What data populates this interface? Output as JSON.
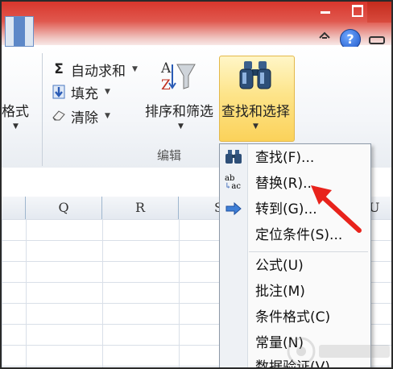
{
  "ribbon": {
    "format_label": "格式",
    "autosum_label": "自动求和",
    "fill_label": "填充",
    "clear_label": "清除",
    "sort_filter_label": "排序和筛选",
    "find_select_label": "查找和选择",
    "group_label": "编辑",
    "sigma_glyph": "Σ",
    "sort_glyph_a": "A",
    "sort_glyph_z": "Z"
  },
  "columns": [
    {
      "label": ""
    },
    {
      "label": "Q"
    },
    {
      "label": "R"
    },
    {
      "label": "S"
    },
    {
      "label": "U"
    }
  ],
  "menu": {
    "items": [
      {
        "label": "查找(F)...",
        "icon": "binoculars-icon"
      },
      {
        "label": "替换(R)...",
        "icon": "replace-ab-ac-icon"
      },
      {
        "label": "转到(G)...",
        "icon": "arrow-right-icon"
      },
      {
        "label": "定位条件(S)...",
        "icon": ""
      },
      {
        "label": "公式(U)",
        "icon": ""
      },
      {
        "label": "批注(M)",
        "icon": ""
      },
      {
        "label": "条件格式(C)",
        "icon": ""
      },
      {
        "label": "常量(N)",
        "icon": ""
      },
      {
        "label": "数据验证(V)",
        "icon": ""
      }
    ],
    "replace_icon_top": "ab",
    "replace_icon_bottom": "ac"
  },
  "title_buttons": {
    "help_glyph": "?"
  },
  "colors": {
    "accent": "#fbd25a",
    "title_red": "#d9362c",
    "arrow_red": "#e8231c"
  }
}
